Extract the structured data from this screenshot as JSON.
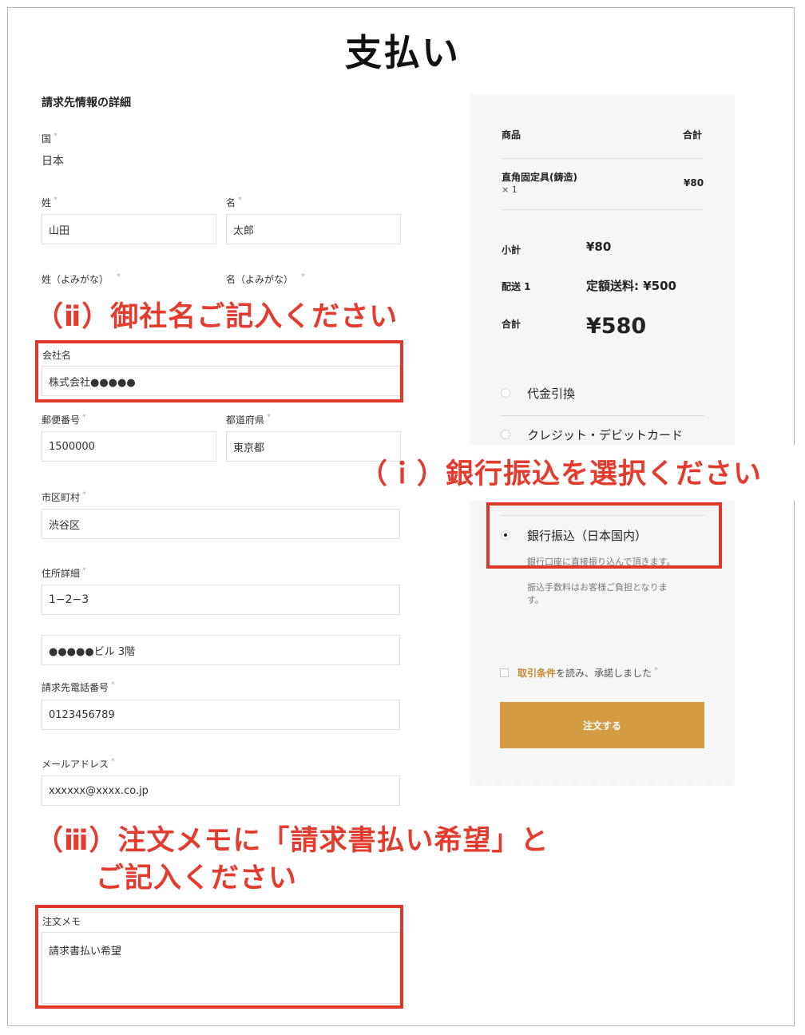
{
  "page": {
    "title": "支払い"
  },
  "billing": {
    "heading": "請求先情報の詳細",
    "required_mark": "*",
    "country": {
      "label": "国",
      "value": "日本"
    },
    "last_name": {
      "label": "姓",
      "value": "山田"
    },
    "first_name": {
      "label": "名",
      "value": "太郎"
    },
    "last_name_kana": {
      "label": "姓（よみがな）"
    },
    "first_name_kana": {
      "label": "名（よみがな）"
    },
    "company": {
      "label": "会社名",
      "value": "株式会社●●●●●"
    },
    "postcode": {
      "label": "郵便番号",
      "value": "1500000"
    },
    "prefecture": {
      "label": "都道府県",
      "value": "東京都"
    },
    "city": {
      "label": "市区町村",
      "value": "渋谷区"
    },
    "address": {
      "label": "住所詳細",
      "value": "1−2−3"
    },
    "address2": {
      "value": "●●●●●ビル 3階"
    },
    "phone": {
      "label": "請求先電話番号",
      "value": "0123456789"
    },
    "email": {
      "label": "メールアドレス",
      "value": "xxxxxx@xxxx.co.jp"
    },
    "order_note": {
      "label": "注文メモ",
      "value": "請求書払い希望"
    }
  },
  "callouts": {
    "company": "（ⅱ）御社名ご記入ください",
    "payment": "（ｉ）銀行振込を選択ください",
    "note_line1": "（ⅲ）注文メモに「請求書払い希望」と",
    "note_line2": "ご記入ください"
  },
  "order": {
    "col_product": "商品",
    "col_total": "合計",
    "item_name": "直角固定具(鋳造)",
    "item_qty": "× 1",
    "item_price": "¥80",
    "subtotal_label": "小計",
    "subtotal_value": "¥80",
    "shipping_label": "配送 1",
    "shipping_value": "定額送料: ¥500",
    "total_label": "合計",
    "total_value": "¥580"
  },
  "payment": {
    "cod": "代金引換",
    "card": "クレジット・デビットカード",
    "bank": "銀行振込（日本国内）",
    "bank_note_1": "銀行口座に直接振り込んで頂きます。",
    "bank_note_2": "振込手数料はお客様ご負担となります。"
  },
  "terms": {
    "link": "取引条件",
    "text": "を読み、承諾しました",
    "required_mark": "*"
  },
  "buttons": {
    "place_order": "注文する"
  },
  "colors": {
    "accent": "#d49d44",
    "callout_red": "#e33c2e",
    "link": "#c48a2c"
  }
}
